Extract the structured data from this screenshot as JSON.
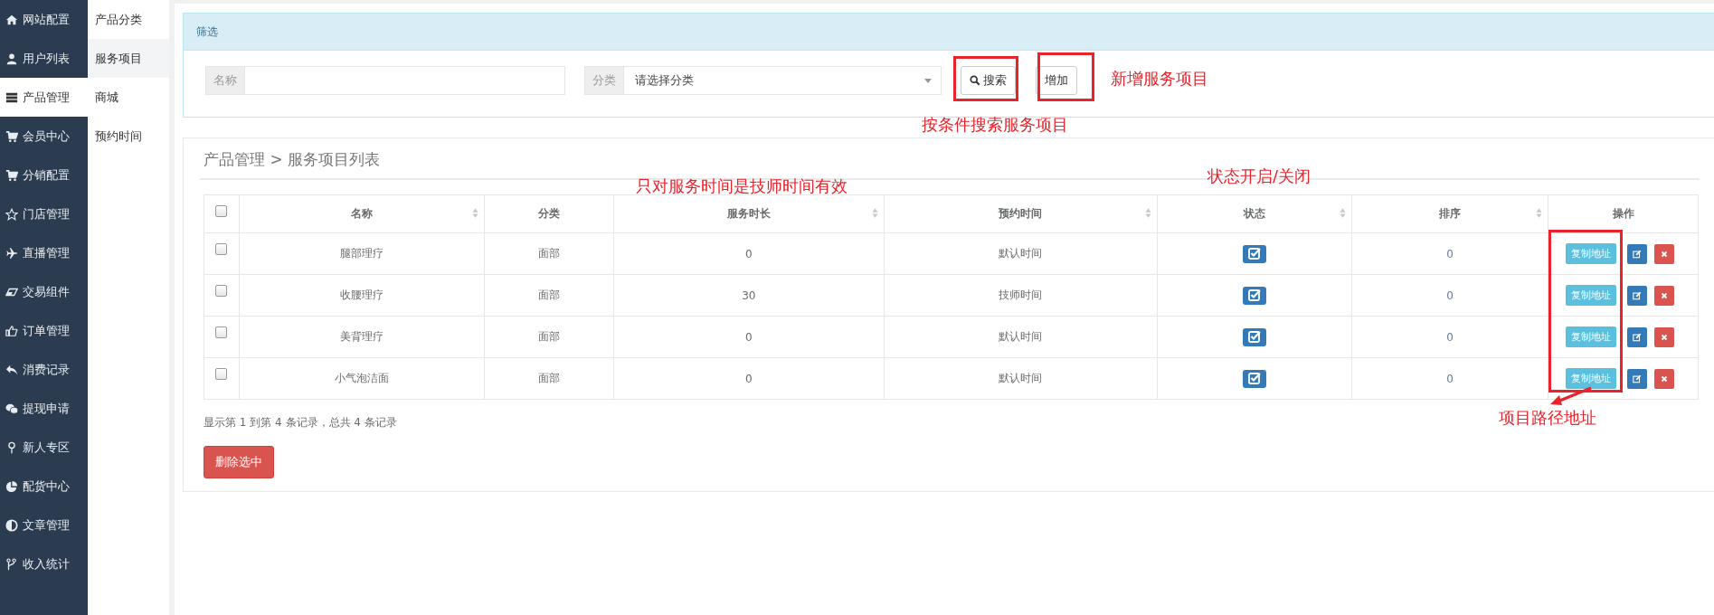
{
  "sidebar": {
    "items": [
      {
        "label": "网站配置",
        "selected": false
      },
      {
        "label": "用户列表",
        "selected": false
      },
      {
        "label": "产品管理",
        "selected": true
      },
      {
        "label": "会员中心",
        "selected": false
      },
      {
        "label": "分销配置",
        "selected": false
      },
      {
        "label": "门店管理",
        "selected": false
      },
      {
        "label": "直播管理",
        "selected": false
      },
      {
        "label": "交易组件",
        "selected": false
      },
      {
        "label": "订单管理",
        "selected": false
      },
      {
        "label": "消费记录",
        "selected": false
      },
      {
        "label": "提现申请",
        "selected": false
      },
      {
        "label": "新人专区",
        "selected": false
      },
      {
        "label": "配货中心",
        "selected": false
      },
      {
        "label": "文章管理",
        "selected": false
      },
      {
        "label": "收入统计",
        "selected": false
      }
    ]
  },
  "submenu": {
    "items": [
      {
        "label": "产品分类",
        "selected": false
      },
      {
        "label": "服务项目",
        "selected": true
      },
      {
        "label": "商城",
        "selected": false
      },
      {
        "label": "预约时间",
        "selected": false
      }
    ]
  },
  "filter": {
    "title": "筛选",
    "name_label": "名称",
    "category_label": "分类",
    "category_placeholder": "请选择分类",
    "search_button": "搜索",
    "add_button": "增加"
  },
  "list": {
    "breadcrumb": "产品管理 > 服务项目列表",
    "select_all_checked": false,
    "columns": [
      {
        "label": "名称",
        "sortable": true
      },
      {
        "label": "分类",
        "sortable": false
      },
      {
        "label": "服务时长",
        "sortable": true
      },
      {
        "label": "预约时间",
        "sortable": true
      },
      {
        "label": "状态",
        "sortable": true
      },
      {
        "label": "排序",
        "sortable": true
      },
      {
        "label": "操作",
        "sortable": false
      }
    ],
    "rows": [
      {
        "checked": false,
        "name": "腿部理疗",
        "category": "面部",
        "duration": "0",
        "appointment": "默认时间",
        "status_on": true,
        "sort": "0",
        "copy_button": "复制地址"
      },
      {
        "checked": false,
        "name": "收腰理疗",
        "category": "面部",
        "duration": "30",
        "appointment": "技师时间",
        "status_on": true,
        "sort": "0",
        "copy_button": "复制地址"
      },
      {
        "checked": false,
        "name": "美背理疗",
        "category": "面部",
        "duration": "0",
        "appointment": "默认时间",
        "status_on": true,
        "sort": "0",
        "copy_button": "复制地址"
      },
      {
        "checked": false,
        "name": "小气泡洁面",
        "category": "面部",
        "duration": "0",
        "appointment": "默认时间",
        "status_on": true,
        "sort": "0",
        "copy_button": "复制地址"
      }
    ],
    "summary": "显示第 1 到第 4 条记录，总共 4 条记录",
    "delete_button": "删除选中"
  },
  "annotations": [
    {
      "text": "新增服务项目"
    },
    {
      "text": "按条件搜索服务项目"
    },
    {
      "text": "只对服务时间是技师时间有效"
    },
    {
      "text": "状态开启/关闭"
    },
    {
      "text": "项目路径地址"
    }
  ]
}
